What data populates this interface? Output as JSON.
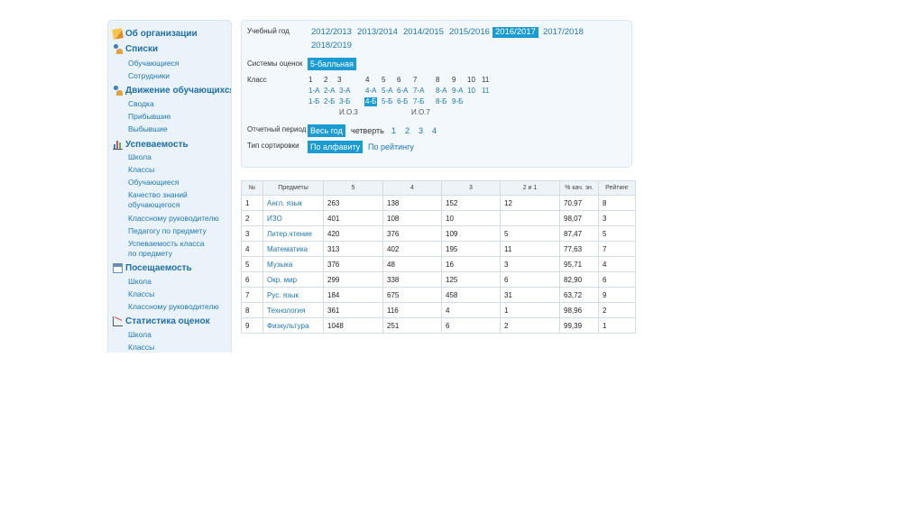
{
  "sidebar": {
    "sections": [
      {
        "title": "Об организации",
        "icon": "pencil-icon",
        "items": []
      },
      {
        "title": "Списки",
        "icon": "users-icon",
        "items": [
          "Обучающиеся",
          "Сотрудники"
        ]
      },
      {
        "title": "Движение обучающихся",
        "icon": "users-move-icon",
        "items": [
          "Сводка",
          "Прибывшие",
          "Выбывшие"
        ]
      },
      {
        "title": "Успеваемость",
        "icon": "bar-chart-icon",
        "items": [
          "Школа",
          "Классы",
          "Обучающиеся",
          "Качество знаний",
          "обучающегося",
          "Классному руководителю",
          "Педагогу по предмету",
          "Успеваемость класса",
          "по предмету"
        ]
      },
      {
        "title": "Посещаемость",
        "icon": "calendar-icon",
        "items": [
          "Школа",
          "Классы",
          "Классному руководителю"
        ]
      },
      {
        "title": "Статистика оценок",
        "icon": "stats-chart-icon",
        "items": [
          "Школа",
          "Классы"
        ]
      }
    ]
  },
  "filters": {
    "year_label": "Учебный год",
    "years": [
      "2012/2013",
      "2013/2014",
      "2014/2015",
      "2015/2016",
      "2016/2017",
      "2017/2018",
      "2018/2019"
    ],
    "year_selected": "2016/2017",
    "grading_label": "Системы оценок",
    "grading_value": "5-балльная",
    "class_label": "Класс",
    "class_headers": [
      "1",
      "2",
      "3",
      "4",
      "5",
      "6",
      "7",
      "8",
      "9",
      "10",
      "11"
    ],
    "class_row1": [
      "1-А",
      "2-А",
      "3-А",
      "4-А",
      "5-А",
      "6-А",
      "7-А",
      "8-А",
      "9-А",
      "10",
      "11"
    ],
    "class_row2": [
      "1-Б",
      "2-Б",
      "3-Б",
      "4-Б",
      "5-Б",
      "6-Б",
      "7-Б",
      "8-Б",
      "9-Б"
    ],
    "class_row3": [
      "И.О.3",
      "И.О.7"
    ],
    "class_selected": "4-Б",
    "period_label": "Отчетный период",
    "period_selected": "Весь год",
    "quarter_label": "четверть",
    "quarters": [
      "1",
      "2",
      "3",
      "4"
    ],
    "sort_label": "Тип сортировки",
    "sort_selected": "По алфавиту",
    "sort_other": "По рейтингу"
  },
  "table": {
    "headers": [
      "№",
      "Предметы",
      "5",
      "4",
      "3",
      "2 и 1",
      "% кач. зн.",
      "Рейтинг"
    ],
    "rows": [
      [
        "1",
        "Англ. язык",
        "263",
        "138",
        "152",
        "12",
        "70,97",
        "8"
      ],
      [
        "2",
        "ИЗО",
        "401",
        "108",
        "10",
        "",
        "98,07",
        "3"
      ],
      [
        "3",
        "Литер.чтение",
        "420",
        "376",
        "109",
        "5",
        "87,47",
        "5"
      ],
      [
        "4",
        "Математика",
        "313",
        "402",
        "195",
        "11",
        "77,63",
        "7"
      ],
      [
        "5",
        "Музыка",
        "376",
        "48",
        "16",
        "3",
        "95,71",
        "4"
      ],
      [
        "6",
        "Окр. мир",
        "299",
        "338",
        "125",
        "6",
        "82,90",
        "6"
      ],
      [
        "7",
        "Рус. язык",
        "184",
        "675",
        "458",
        "31",
        "63,72",
        "9"
      ],
      [
        "8",
        "Технология",
        "361",
        "116",
        "4",
        "1",
        "98,96",
        "2"
      ],
      [
        "9",
        "Физкультура",
        "1048",
        "251",
        "6",
        "2",
        "99,39",
        "1"
      ]
    ]
  },
  "colors": {
    "accent": "#1a9bd1",
    "link": "#1f78b4",
    "sidebar_bg": "#eaf3fa",
    "panel_bg": "#f2f8fc"
  }
}
